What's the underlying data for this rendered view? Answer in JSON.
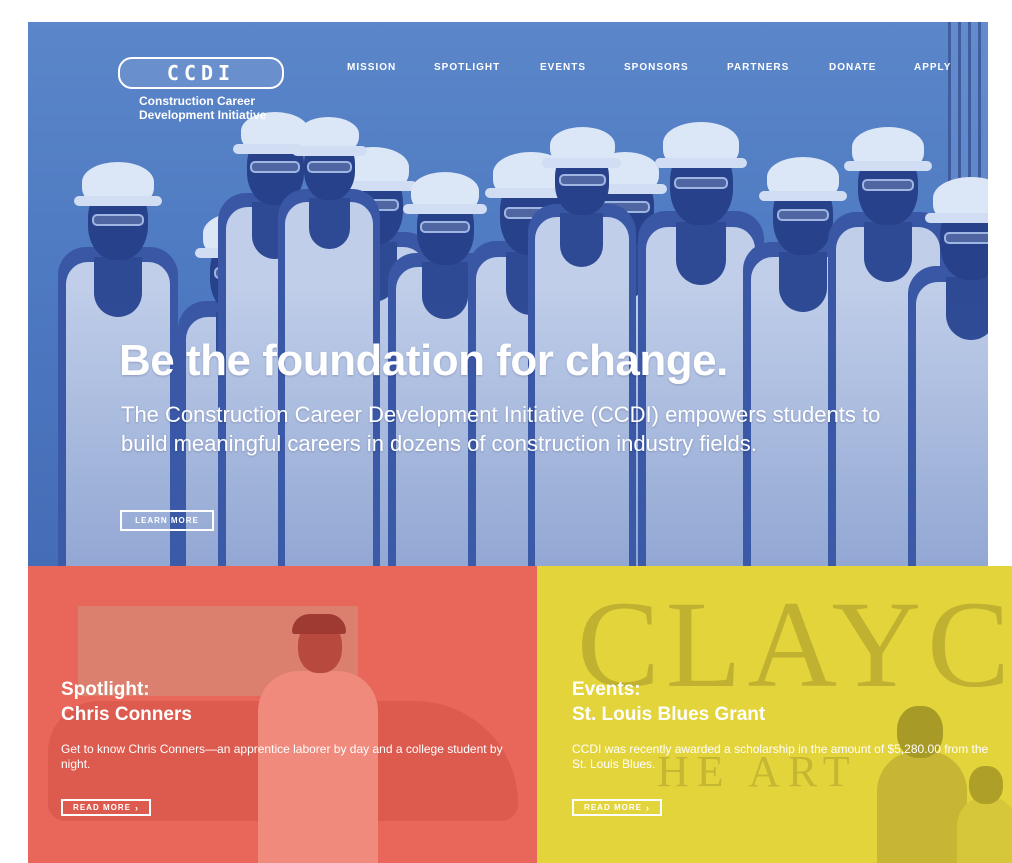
{
  "logo": {
    "mark": "CCDI",
    "line1": "Construction Career",
    "line2": "Development Initiative"
  },
  "nav": {
    "items": [
      {
        "label": "MISSION"
      },
      {
        "label": "SPOTLIGHT"
      },
      {
        "label": "EVENTS"
      },
      {
        "label": "SPONSORS"
      },
      {
        "label": "PARTNERS"
      },
      {
        "label": "DONATE"
      },
      {
        "label": "APPLY"
      }
    ]
  },
  "hero": {
    "headline": "Be the foundation for change.",
    "intro": "The Construction Career Development Initiative (CCDI) empowers students to build meaningful careers in dozens of construction industry fields.",
    "button": "LEARN MORE"
  },
  "spotlight": {
    "kicker": "Spotlight:",
    "title": "Chris Conners",
    "body": "Get to know Chris Conners—an apprentice laborer by day and a college student by night.",
    "button": "READ MORE",
    "color": "#e8665a"
  },
  "events": {
    "kicker": "Events:",
    "title": "St. Louis Blues Grant",
    "body": "CCDI was recently awarded a scholarship in the amount of $5,280.00 from the St. Louis Blues.",
    "button": "READ MORE",
    "color": "#e4d43c"
  },
  "colors": {
    "hero_blue": "#4e7ac2",
    "text": "#ffffff"
  },
  "icons": {
    "read_more": "chevron-right-icon"
  }
}
